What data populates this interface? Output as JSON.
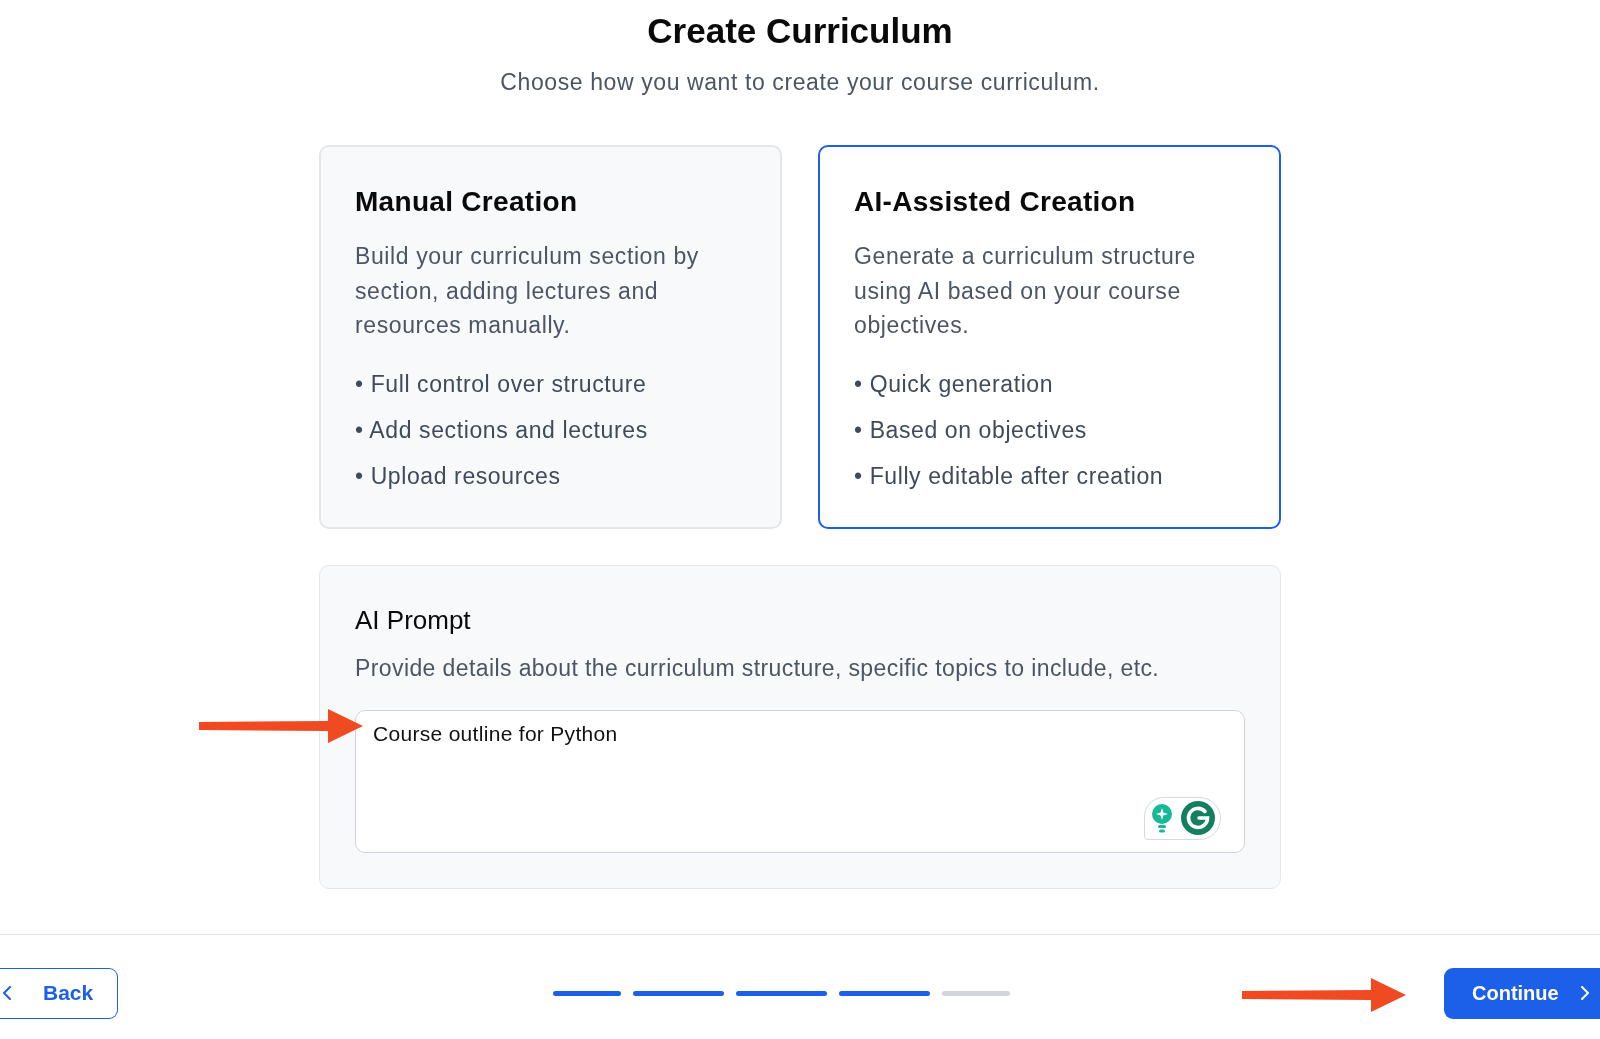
{
  "header": {
    "title": "Create Curriculum",
    "subtitle": "Choose how you want to create your course curriculum."
  },
  "options": [
    {
      "title": "Manual Creation",
      "description": "Build your curriculum section by section, adding lectures and resources manually.",
      "features": [
        "• Full control over structure",
        "• Add sections and lectures",
        "• Upload resources"
      ],
      "selected": false
    },
    {
      "title": "AI-Assisted Creation",
      "description": "Generate a curriculum structure using AI based on your course objectives.",
      "features": [
        "• Quick generation",
        "• Based on objectives",
        "• Fully editable after creation"
      ],
      "selected": true
    }
  ],
  "prompt": {
    "title": "AI Prompt",
    "description": "Provide details about the curriculum structure, specific topics to include, etc.",
    "value": "Course outline for Python"
  },
  "footer": {
    "back": "Back",
    "progress": [
      {
        "done": true
      },
      {
        "done": true
      },
      {
        "done": true
      },
      {
        "done": true
      },
      {
        "done": false
      }
    ],
    "continue": "Continue"
  }
}
